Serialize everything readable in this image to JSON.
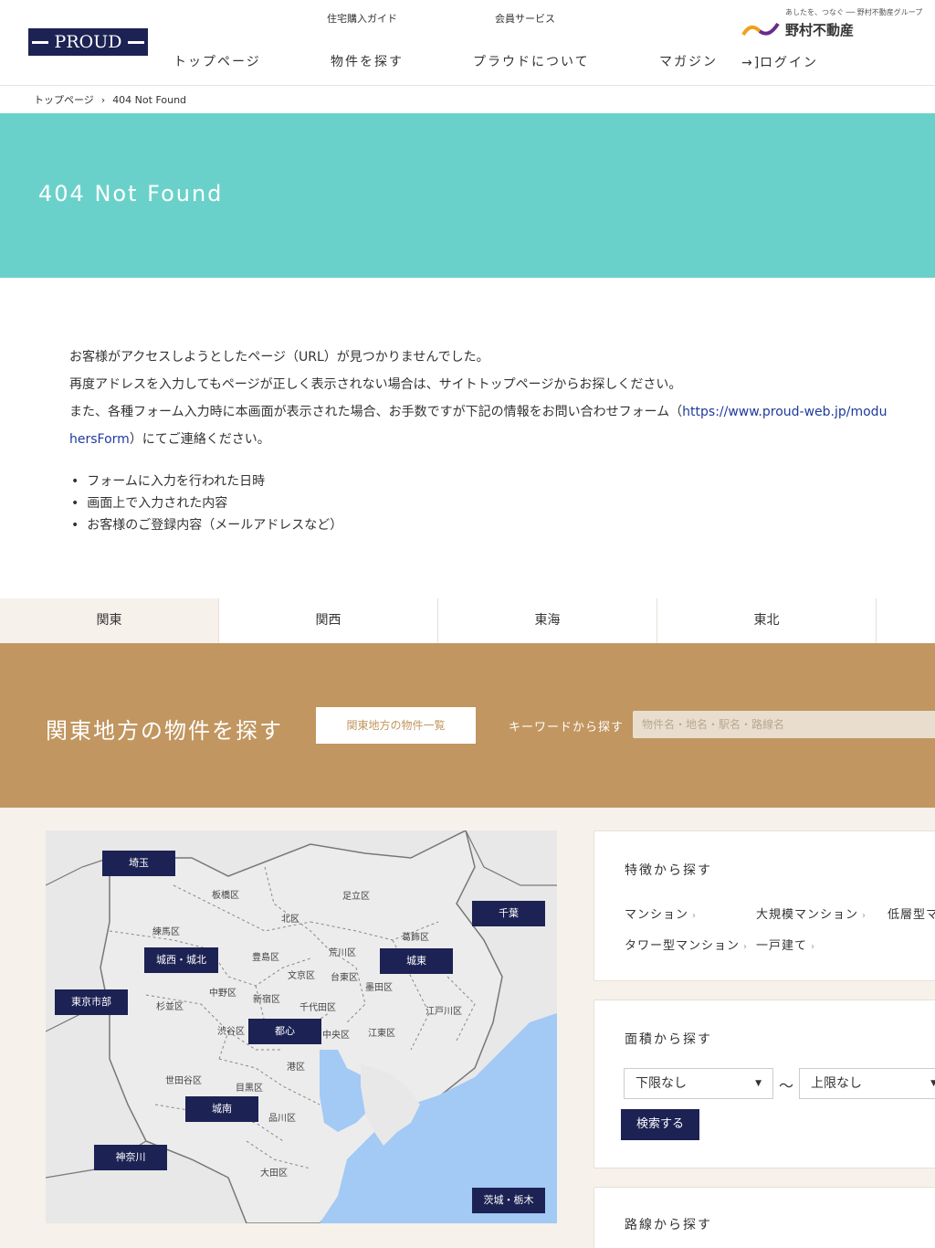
{
  "header": {
    "logo": "PROUD",
    "sub_nav": [
      "住宅購入ガイド",
      "会員サービス"
    ],
    "main_nav": [
      "トップページ",
      "物件を探す",
      "プラウドについて",
      "マガジン"
    ],
    "nomura_tagline": "あしたを、つなぐ ── 野村不動産グループ",
    "nomura_name": "野村不動産",
    "login": "ログイン"
  },
  "breadcrumb": {
    "home": "トップページ",
    "current": "404 Not Found"
  },
  "hero": {
    "title": "404 Not Found"
  },
  "message": {
    "line1": "お客様がアクセスしようとしたページ（URL）が見つかりませんでした。",
    "line2": "再度アドレスを入力してもページが正しく表示されない場合は、サイトトップページからお探しください。",
    "line3_pre": "また、各種フォーム入力時に本画面が表示された場合、お手数ですが下記の情報をお問い合わせフォーム（",
    "line3_link": "https://www.proud-web.jp/modu",
    "line4_link": "hersForm",
    "line4_post": "）にてご連絡ください。",
    "bullets": [
      "フォームに入力を行われた日時",
      "画面上で入力された内容",
      "お客様のご登録内容（メールアドレスなど）"
    ]
  },
  "region_tabs": [
    "関東",
    "関西",
    "東海",
    "東北"
  ],
  "search_band": {
    "title": "関東地方の物件を探す",
    "list_button": "関東地方の物件一覧",
    "keyword_label": "キーワードから探す",
    "keyword_placeholder": "物件名・地名・駅名・路線名"
  },
  "map": {
    "areas": [
      "埼玉",
      "千葉",
      "城西・城北",
      "城東",
      "東京市部",
      "都心",
      "城南",
      "神奈川",
      "茨城・栃木"
    ],
    "wards": [
      "板橋区",
      "足立区",
      "北区",
      "練馬区",
      "葛飾区",
      "荒川区",
      "豊島区",
      "文京区",
      "台東区",
      "中野区",
      "新宿区",
      "墨田区",
      "杉並区",
      "千代田区",
      "江戸川区",
      "渋谷区",
      "中央区",
      "江東区",
      "港区",
      "世田谷区",
      "目黒区",
      "品川区",
      "大田区"
    ]
  },
  "feature_panel": {
    "title": "特徴から探す",
    "items": [
      "マンション",
      "大規模マンション",
      "低層型マ",
      "タワー型マンション",
      "一戸建て"
    ]
  },
  "area_panel": {
    "title": "面積から探す",
    "min_select": "下限なし",
    "tilde": "～",
    "max_select": "上限なし",
    "search_button": "検索する"
  },
  "route_panel": {
    "title": "路線から探す"
  },
  "colors": {
    "navy": "#1c2253",
    "teal": "#6ad1ca",
    "gold": "#c19660",
    "cream": "#f7f1eb",
    "water": "#a3c9f5"
  }
}
